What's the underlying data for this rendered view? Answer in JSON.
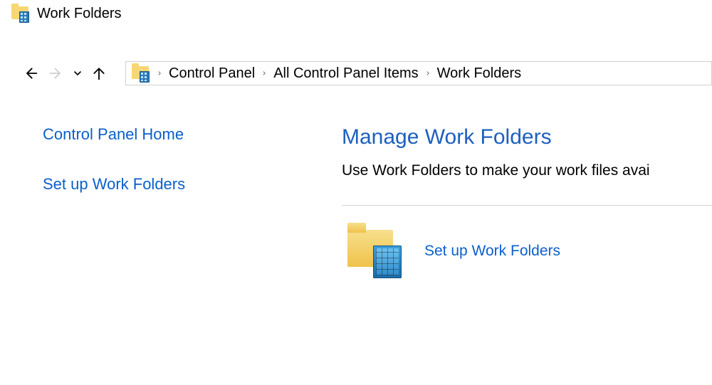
{
  "titlebar": {
    "title": "Work Folders"
  },
  "breadcrumb": {
    "items": [
      "Control Panel",
      "All Control Panel Items",
      "Work Folders"
    ]
  },
  "sidepanel": {
    "home_link": "Control Panel Home",
    "setup_link": "Set up Work Folders"
  },
  "main": {
    "heading": "Manage Work Folders",
    "description": "Use Work Folders to make your work files avai",
    "setup_link": "Set up Work Folders"
  }
}
